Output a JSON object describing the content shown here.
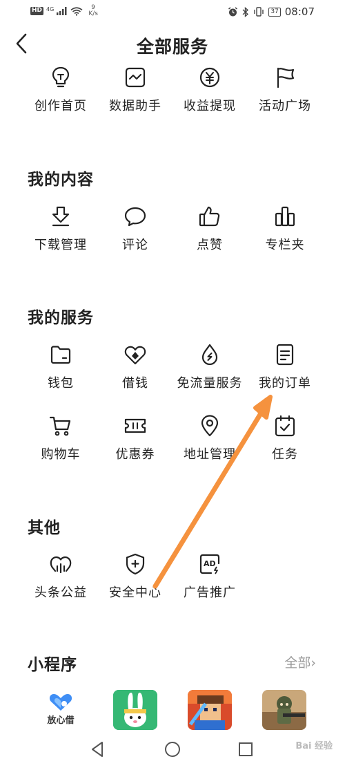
{
  "statusbar": {
    "left_badge": "HD",
    "network": "4G",
    "speed_value": "9",
    "speed_unit": "K/s",
    "battery": "37",
    "time": "08:07"
  },
  "header": {
    "title": "全部服务"
  },
  "top_row": [
    {
      "label": "创作首页",
      "icon": "lightbulb-icon"
    },
    {
      "label": "数据助手",
      "icon": "chart-icon"
    },
    {
      "label": "收益提现",
      "icon": "yuan-icon"
    },
    {
      "label": "活动广场",
      "icon": "flag-icon"
    }
  ],
  "my_content": {
    "title": "我的内容",
    "items": [
      {
        "label": "下载管理",
        "icon": "download-icon"
      },
      {
        "label": "评论",
        "icon": "comment-icon"
      },
      {
        "label": "点赞",
        "icon": "thumbs-up-icon"
      },
      {
        "label": "专栏夹",
        "icon": "column-icon"
      }
    ]
  },
  "my_services": {
    "title": "我的服务",
    "items": [
      {
        "label": "钱包",
        "icon": "wallet-icon"
      },
      {
        "label": "借钱",
        "icon": "borrow-icon"
      },
      {
        "label": "免流量服务",
        "icon": "free-data-icon"
      },
      {
        "label": "我的订单",
        "icon": "order-icon"
      },
      {
        "label": "购物车",
        "icon": "cart-icon"
      },
      {
        "label": "优惠券",
        "icon": "coupon-icon"
      },
      {
        "label": "地址管理",
        "icon": "location-icon"
      },
      {
        "label": "任务",
        "icon": "task-icon"
      }
    ]
  },
  "others": {
    "title": "其他",
    "items": [
      {
        "label": "头条公益",
        "icon": "charity-icon"
      },
      {
        "label": "安全中心",
        "icon": "shield-icon"
      },
      {
        "label": "广告推广",
        "icon": "ad-icon"
      }
    ]
  },
  "mini_programs": {
    "title": "小程序",
    "more_label": "全部",
    "items": [
      {
        "label": "放心借",
        "icon": "fangxinjie-logo"
      },
      {
        "icon": "rabbit-game-icon"
      },
      {
        "icon": "block-game-icon"
      },
      {
        "icon": "shooter-game-icon"
      }
    ]
  },
  "watermark": "Bai 经验",
  "colors": {
    "arrow": "#F5923E",
    "text": "#222222",
    "muted": "#999999"
  }
}
